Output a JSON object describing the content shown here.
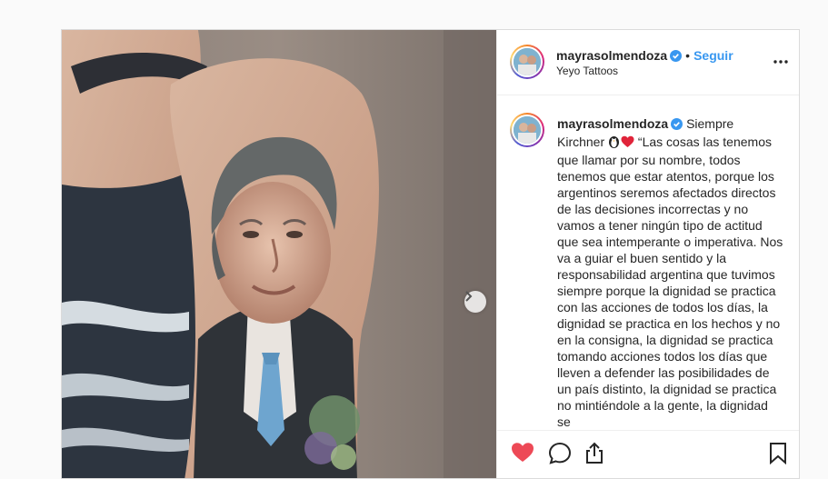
{
  "post": {
    "author": {
      "username": "mayrasolmendoza",
      "verified": true,
      "follow_label": "Seguir",
      "separator": "•",
      "location": "Yeyo Tattoos"
    },
    "caption": {
      "username": "mayrasolmendoza",
      "text_start": "Siempre Kirchner",
      "emoji": [
        "penguin-icon",
        "red-heart-icon"
      ],
      "text": "“Las cosas las tenemos que llamar por su nombre, todos tenemos que estar atentos, porque los argentinos seremos afectados directos de las decisiones incorrectas y no vamos a tener ningún tipo de actitud que sea intemperante o imperativa. Nos va a guiar el buen sentido y la responsabilidad argentina que tuvimos siempre porque la dignidad se practica con las acciones de todos los días, la dignidad se practica en los hechos y no en la consigna, la dignidad se practica tomando acciones todos los días que lleven a defender las posibilidades de un país distinto, la dignidad se practica no mintiéndole a la gente, la dignidad se"
    },
    "media": {
      "description_icon": "tattoo-photo",
      "next_icon": "chevron-right-icon"
    },
    "actions": [
      "heart-icon-liked",
      "comment-icon",
      "share-icon",
      "bookmark-icon"
    ],
    "colors": {
      "accent": "#3897f0",
      "like": "#ed4956",
      "verified": "#3897f0",
      "border": "#dbdbdb"
    }
  }
}
